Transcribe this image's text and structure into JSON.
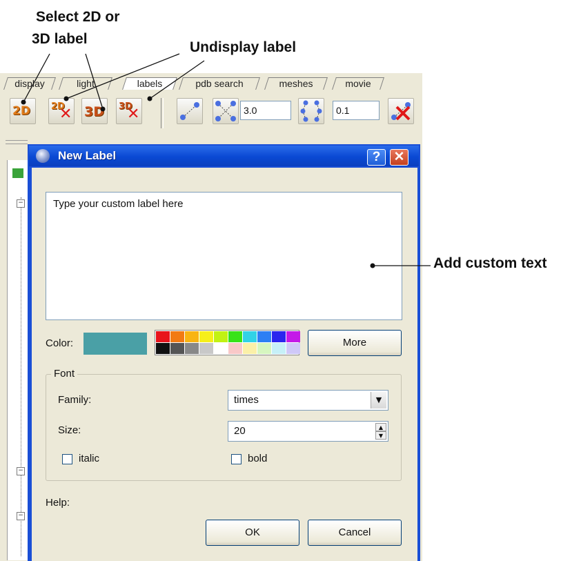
{
  "callouts": {
    "select_label": "Select 2D or\n3D label",
    "select_line1": "Select 2D or",
    "select_line2": "3D label",
    "undisplay": "Undisplay label",
    "add_text": "Add custom text"
  },
  "tabs": [
    "display",
    "light",
    "labels",
    "pdb search",
    "meshes",
    "movie"
  ],
  "active_tab": "labels",
  "toolbar": {
    "btn_2d": "2D",
    "btn_2d_off": "2D",
    "btn_3d": "3D",
    "btn_3d_off": "3D",
    "input1": "3.0",
    "input2": "0.1"
  },
  "dialog": {
    "title": "New Label",
    "help_button": "?",
    "close_button": "✕",
    "text_value": "Type your custom label here",
    "color_label": "Color:",
    "selected_color": "#4aa0a6",
    "more_button": "More",
    "palette": [
      "#e8141c",
      "#f27a13",
      "#f8b412",
      "#f6ef1a",
      "#c2f213",
      "#38e219",
      "#31d2e6",
      "#2d7ff4",
      "#2a25ee",
      "#c419e8",
      "#111111",
      "#555555",
      "#888888",
      "#c8c8c8",
      "#ffffff",
      "#f9c8c8",
      "#fbf0a8",
      "#d6f6c0",
      "#c6f0f8",
      "#cfc8f8"
    ],
    "font_group": "Font",
    "family_label": "Family:",
    "family_value": "times",
    "size_label": "Size:",
    "size_value": "20",
    "italic_label": "italic",
    "bold_label": "bold",
    "help_label": "Help:",
    "ok_button": "OK",
    "cancel_button": "Cancel"
  }
}
